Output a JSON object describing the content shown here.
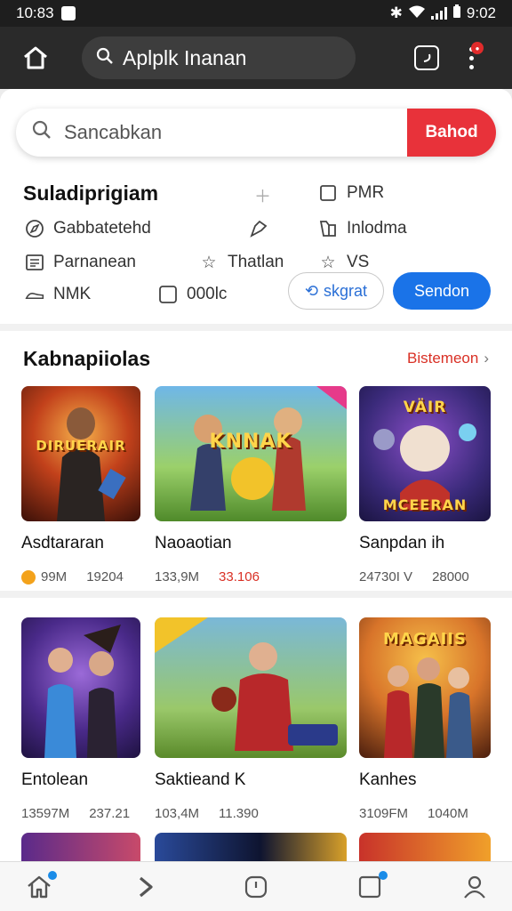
{
  "statusbar": {
    "left_text": "10:83",
    "time": "9:02"
  },
  "appbar": {
    "url_text": "Aplplk Inanan"
  },
  "search": {
    "placeholder": "Sancabkan",
    "button_label": "Bahod"
  },
  "quick": {
    "title": "Suladiprigiam",
    "items": {
      "gabb": "Gabbatetehd",
      "pmr": "PMR",
      "inlo": "Inlodma",
      "parn": "Parnanean",
      "thatlan": "Thatlan",
      "vs": "VS",
      "nmk": "NMK",
      "oool": "000lc"
    },
    "skgrat_label": "skgrat",
    "send_label": "Sendon"
  },
  "section1": {
    "title": "Kabnapiiolas",
    "see_all": "Bistemeon",
    "cards": [
      {
        "name": "Asdtararan",
        "meta1": "99M",
        "meta2": "19204",
        "thumb_text": "DIRUERAIR"
      },
      {
        "name": "Naoaotian",
        "meta1": "133,9M",
        "meta2": "33.106",
        "thumb_text": "KNNAK"
      },
      {
        "name": "Sanpdan ih",
        "meta1": "24730I V",
        "meta2": "28000",
        "thumb_text": "MCEERAN"
      }
    ]
  },
  "section2": {
    "cards": [
      {
        "name": "Entolean",
        "meta1": "13597M",
        "meta2": "237.21"
      },
      {
        "name": "Saktieand K",
        "meta1": "103,4M",
        "meta2": "11.390"
      },
      {
        "name": "Kanhes",
        "meta1": "3109FM",
        "meta2": "1040M",
        "thumb_text": "MAGAIIS"
      }
    ]
  },
  "colors": {
    "accent_red": "#e8323a",
    "accent_blue": "#1a73e8",
    "link_red": "#d93025"
  }
}
